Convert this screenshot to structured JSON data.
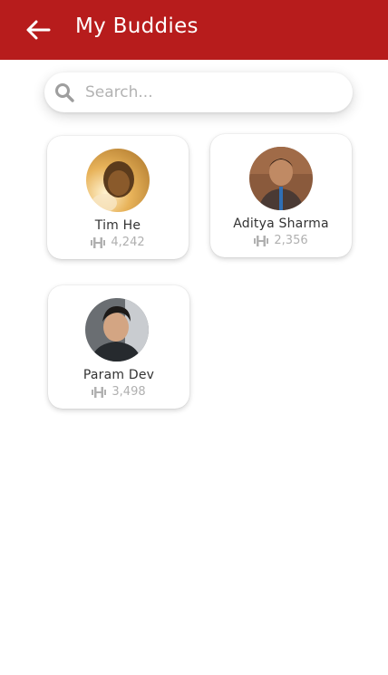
{
  "header": {
    "title": "My Buddies",
    "back_icon": "arrow-left-icon",
    "background_color": "#b71c1c"
  },
  "search": {
    "placeholder": "Search...",
    "value": "",
    "icon": "search-icon"
  },
  "buddies": [
    {
      "name": "Tim He",
      "stat": "4,242",
      "stat_icon": "dumbbell-icon"
    },
    {
      "name": "Aditya Sharma",
      "stat": "2,356",
      "stat_icon": "dumbbell-icon"
    },
    {
      "name": "Param Dev",
      "stat": "3,498",
      "stat_icon": "dumbbell-icon"
    }
  ]
}
